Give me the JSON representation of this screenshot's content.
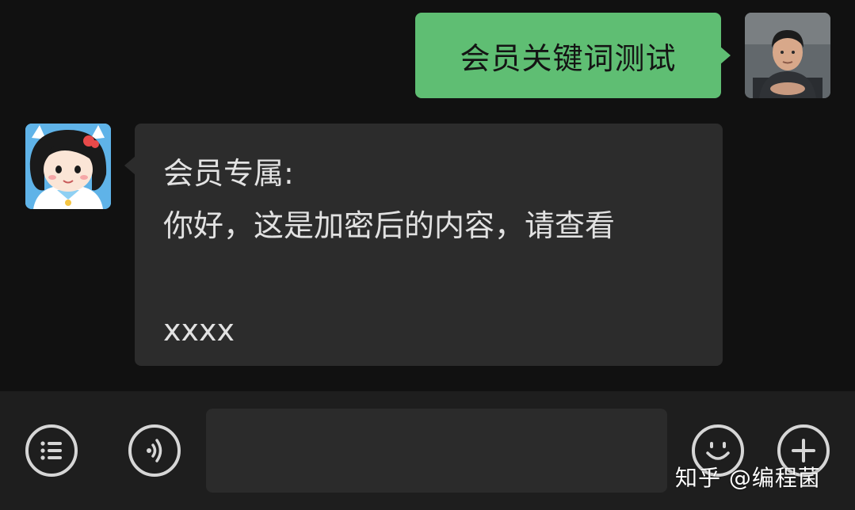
{
  "conversation": {
    "outgoing_message": "会员关键词测试",
    "incoming_message": {
      "line1": "会员专属:",
      "line2": "你好，这是加密后的内容，请查看",
      "line3": "",
      "line4": "xxxx"
    }
  },
  "input_bar": {
    "left_button_icon": "list-menu-icon",
    "voice_button_icon": "voice-icon",
    "emoji_button_icon": "emoji-icon",
    "add_button_icon": "plus-icon"
  },
  "watermark": "知乎 @编程菌",
  "colors": {
    "background": "#111111",
    "outgoing_bubble": "#5fbe73",
    "incoming_bubble": "#2c2c2c",
    "input_bar": "#1e1e1e"
  }
}
